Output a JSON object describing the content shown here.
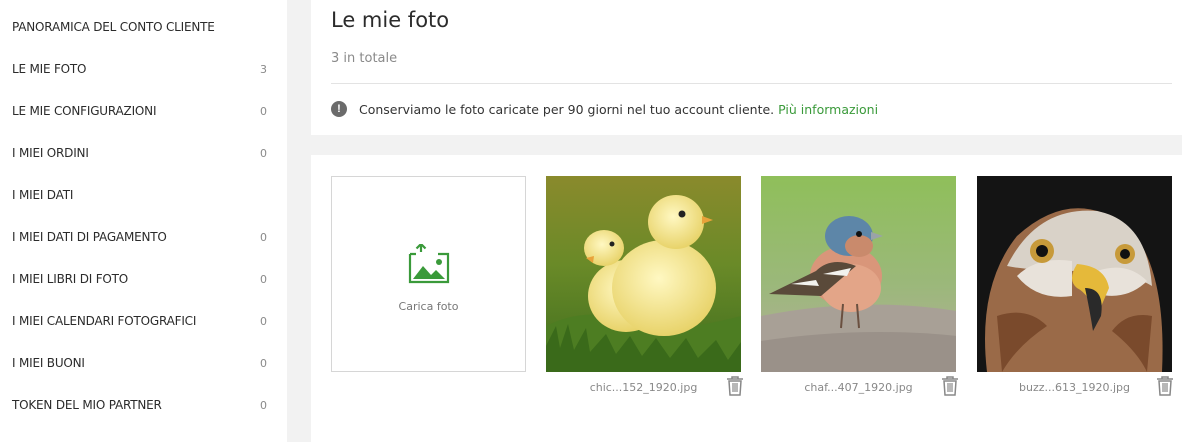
{
  "sidebar": {
    "items": [
      {
        "label": "PANORAMICA DEL CONTO CLIENTE",
        "count": ""
      },
      {
        "label": "LE MIE FOTO",
        "count": "3"
      },
      {
        "label": "LE MIE CONFIGURAZIONI",
        "count": "0"
      },
      {
        "label": "I MIEI ORDINI",
        "count": "0"
      },
      {
        "label": "I MIEI DATI",
        "count": ""
      },
      {
        "label": "I MIEI DATI DI PAGAMENTO",
        "count": "0"
      },
      {
        "label": "I MIEI LIBRI DI FOTO",
        "count": "0"
      },
      {
        "label": "I MIEI CALENDARI FOTOGRAFICI",
        "count": "0"
      },
      {
        "label": "I MIEI BUONI",
        "count": "0"
      },
      {
        "label": "TOKEN DEL MIO PARTNER",
        "count": "0"
      }
    ]
  },
  "header": {
    "title": "Le mie foto",
    "subtitle": "3 in totale",
    "info_text": "Conserviamo le foto caricate per 90 giorni nel tuo account cliente.",
    "info_link": "Più informazioni"
  },
  "gallery": {
    "upload_label": "Carica foto",
    "photos": [
      {
        "filename": "chic...152_1920.jpg",
        "subject": "chicks"
      },
      {
        "filename": "chaf...407_1920.jpg",
        "subject": "chaffinch"
      },
      {
        "filename": "buzz...613_1920.jpg",
        "subject": "buzzard"
      }
    ]
  },
  "colors": {
    "accent_green": "#3a9a3a",
    "background": "#f2f2f2"
  },
  "icons": {
    "info": "exclamation-circle-icon",
    "upload": "image-upload-icon",
    "delete": "trash-icon"
  }
}
